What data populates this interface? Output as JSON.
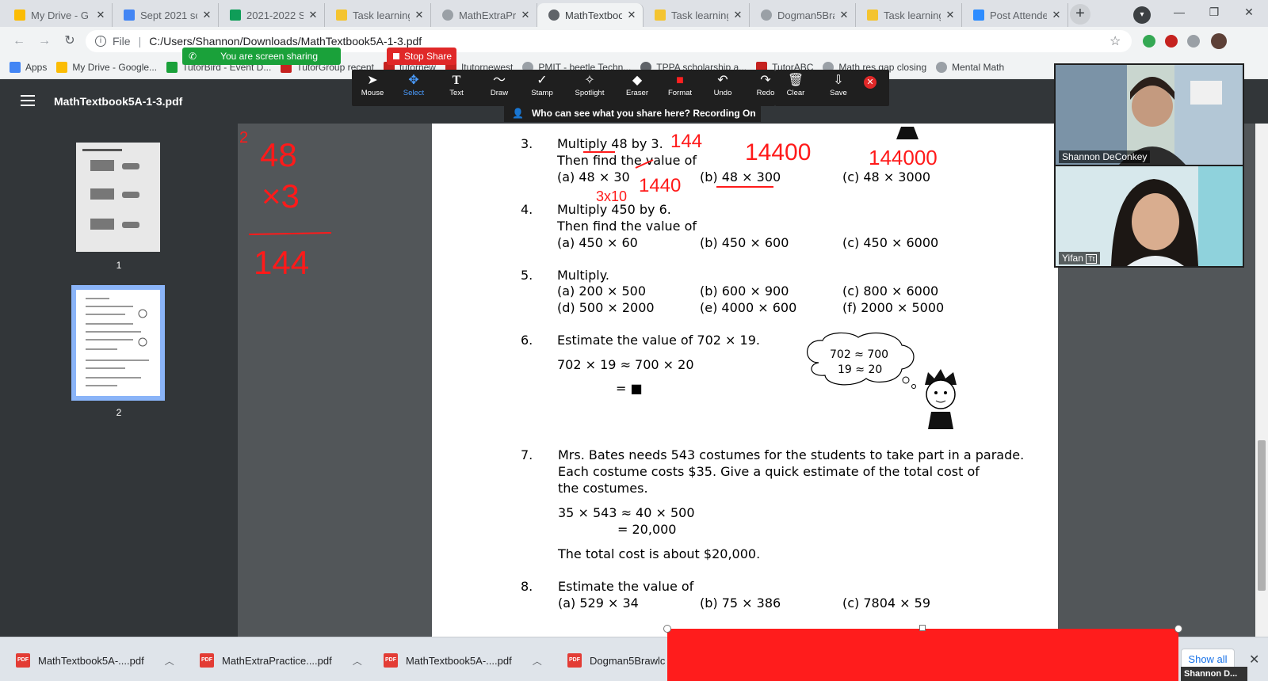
{
  "tabs": [
    {
      "label": "My Drive - G",
      "color": "#fbbc04"
    },
    {
      "label": "Sept 2021 sc",
      "color": "#4285f4"
    },
    {
      "label": "2021-2022 S",
      "color": "#0f9d58"
    },
    {
      "label": "Task learning",
      "color": "#f4c430"
    },
    {
      "label": "MathExtraPr",
      "color": "#5f6368"
    },
    {
      "label": "MathTextboo",
      "color": "#5f6368"
    },
    {
      "label": "Task learning",
      "color": "#f4c430"
    },
    {
      "label": "Dogman5Bra",
      "color": "#5f6368"
    },
    {
      "label": "Task learning",
      "color": "#f4c430"
    },
    {
      "label": "Post Attende",
      "color": "#2d8cff"
    }
  ],
  "close_glyph": "✕",
  "address": {
    "scheme": "File",
    "url": "C:/Users/Shannon/Downloads/MathTextbook5A-1-3.pdf"
  },
  "bookmarks": [
    "Apps",
    "My Drive - Google...",
    "TutorBird - Event D...",
    "TutorGroup recent",
    "tutornew",
    "Itutornewest",
    "PMIT - beetle Techn...",
    "TPPA scholarship a...",
    "TutorABC",
    "Math res gap closing",
    "Mental Math"
  ],
  "zoom": {
    "screen_sharing": "You are screen sharing",
    "stop_share": "Stop Share",
    "tools": [
      {
        "label": "Mouse",
        "glyph": "➤"
      },
      {
        "label": "Select",
        "glyph": "✥"
      },
      {
        "label": "Text",
        "glyph": "T"
      },
      {
        "label": "Draw",
        "glyph": "〜"
      },
      {
        "label": "Stamp",
        "glyph": "✓"
      },
      {
        "label": "Spotlight",
        "glyph": "✧"
      },
      {
        "label": "Eraser",
        "glyph": "◆"
      },
      {
        "label": "Format",
        "glyph": "■"
      },
      {
        "label": "Undo",
        "glyph": "↶"
      },
      {
        "label": "Redo",
        "glyph": "↷"
      },
      {
        "label": "Clear",
        "glyph": "🗑"
      },
      {
        "label": "Save",
        "glyph": "⇩"
      }
    ],
    "recording_notice": "Who can see what you share here? Recording On",
    "participants": [
      {
        "name": "Shannon DeConkey"
      },
      {
        "name": "Yifan"
      }
    ]
  },
  "pdf": {
    "title": "MathTextbook5A-1-3.pdf",
    "thumbnails": [
      {
        "label": "1"
      },
      {
        "label": "2"
      }
    ],
    "problems": {
      "p3_num": "3.",
      "p3_line1": "Multiply 48 by 3.",
      "p3_line2": "Then find the value of",
      "p3_a": "(a)   48 × 30",
      "p3_b": "(b)   48 × 300",
      "p3_c": "(c)   48 × 3000",
      "p4_num": "4.",
      "p4_line1": "Multiply 450 by 6.",
      "p4_line2": "Then find the value of",
      "p4_a": "(a)   450 × 60",
      "p4_b": "(b)   450 × 600",
      "p4_c": "(c)   450 × 6000",
      "p5_num": "5.",
      "p5_line1": "Multiply.",
      "p5_a": "(a)   200 × 500",
      "p5_b": "(b)   600 × 900",
      "p5_c": "(c)   800 × 6000",
      "p5_d": "(d)   500 × 2000",
      "p5_e": "(e)   4000 × 600",
      "p5_f": "(f)   2000 × 5000",
      "p6_num": "6.",
      "p6_line1": "Estimate the value of 702 × 19.",
      "p6_work": "702 × 19 ≈ 700 × 20",
      "p6_eq": "= ■",
      "p6_bubble1": "702 ≈ 700",
      "p6_bubble2": "19 ≈ 20",
      "p7_num": "7.",
      "p7_line1": "Mrs. Bates needs 543 costumes for the students to take part in a parade.",
      "p7_line2": "Each costume costs $35. Give a quick estimate of the total cost of",
      "p7_line3": "the costumes.",
      "p7_work1": "35 × 543 ≈ 40 × 500",
      "p7_work2": "= 20,000",
      "p7_answer": "The total cost is about $20,000.",
      "p8_num": "8.",
      "p8_line1": "Estimate the value of",
      "p8_a": "(a)   529 × 34",
      "p8_b": "(b)   75 ×  386",
      "p8_c": "(c)   7804 × 59"
    },
    "annotations": {
      "left_top": "48",
      "left_mult": "×3",
      "left_result": "144",
      "n144": "144",
      "n14400": "14400",
      "n144000": "144000",
      "n1440": "1440",
      "n3x10": "3x10",
      "stray": "2",
      "color": "#ff1a1a"
    }
  },
  "downloads": {
    "items": [
      "MathTextbook5A-....pdf",
      "MathExtraPractice....pdf",
      "MathTextbook5A-....pdf",
      "Dogman5Brawlc"
    ],
    "show_all": "Show all",
    "speaker": "Shannon D..."
  }
}
